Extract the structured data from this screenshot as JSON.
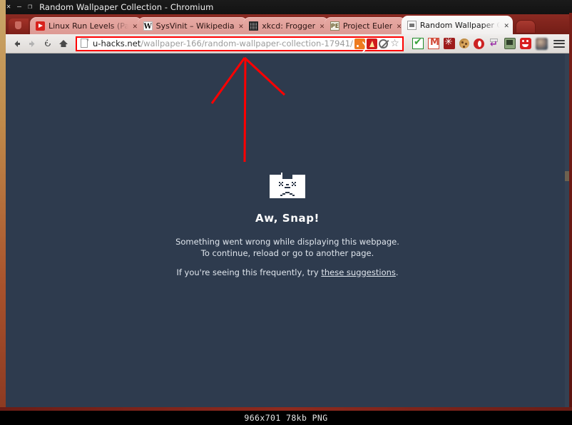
{
  "window": {
    "title": "Random Wallpaper Collection - Chromium",
    "controls": [
      {
        "name": "close",
        "glyph": "✕"
      },
      {
        "name": "minimize",
        "glyph": "—"
      },
      {
        "name": "maximize",
        "glyph": "❐"
      }
    ]
  },
  "tabs": [
    {
      "label": "Linux Run Levels (Pa",
      "favicon": "youtube-icon",
      "close": "✕",
      "active": false,
      "fade": true
    },
    {
      "label": "SysVinit – Wikipedia",
      "favicon": "wikipedia-icon",
      "close": "✕",
      "active": false,
      "fade": false
    },
    {
      "label": "xkcd: Frogger",
      "favicon": "xkcd-icon",
      "close": "✕",
      "active": false,
      "fade": false
    },
    {
      "label": "Project Euler",
      "favicon": "project-euler-icon",
      "close": "✕",
      "active": false,
      "fade": false
    },
    {
      "label": "Random Wallpaper C",
      "favicon": "page-icon",
      "close": "✕",
      "active": true,
      "fade": true
    }
  ],
  "toolbar": {
    "back_label": "Back",
    "forward_label": "Forward",
    "reload_label": "Reload",
    "home_label": "Home",
    "url_host": "u-hacks.net",
    "url_path": "/wallpaper-166/random-wallpaper-collection-17941/",
    "url_full": "u-hacks.net/wallpaper-166/random-wallpaper-collection-17941/",
    "omnibox_icons": [
      {
        "name": "rss-icon",
        "title": "Subscribe"
      },
      {
        "name": "adobe-pdf-icon",
        "title": "PDF"
      },
      {
        "name": "block-icon",
        "title": "Blocked"
      },
      {
        "name": "bookmark-star-icon",
        "title": "Bookmark",
        "glyph": "☆"
      }
    ],
    "extensions": [
      {
        "name": "checkmark-extension-icon"
      },
      {
        "name": "gmail-extension-icon"
      },
      {
        "name": "asterisk-extension-icon"
      },
      {
        "name": "cookie-extension-icon"
      },
      {
        "name": "opera-extension-icon"
      },
      {
        "name": "purple-arrow-extension-icon"
      },
      {
        "name": "monitor-extension-icon"
      },
      {
        "name": "red-face-extension-icon"
      },
      {
        "name": "avatar-icon"
      }
    ],
    "menu_label": "Customize and control Chromium"
  },
  "page": {
    "error_icon": "sad-folder-icon",
    "title": "Aw, Snap!",
    "line1": "Something went wrong while displaying this webpage.",
    "line2": "To continue, reload or go to another page.",
    "line3_prefix": "If you're seeing this frequently, try ",
    "link": "these suggestions",
    "line3_suffix": ".",
    "background_color": "#2e3b4e",
    "annotation": {
      "name": "red-arrow-annotation",
      "color": "#ff0000",
      "points_to": "address-bar"
    }
  },
  "statusbar": {
    "text": "966x701  78kb  PNG"
  }
}
